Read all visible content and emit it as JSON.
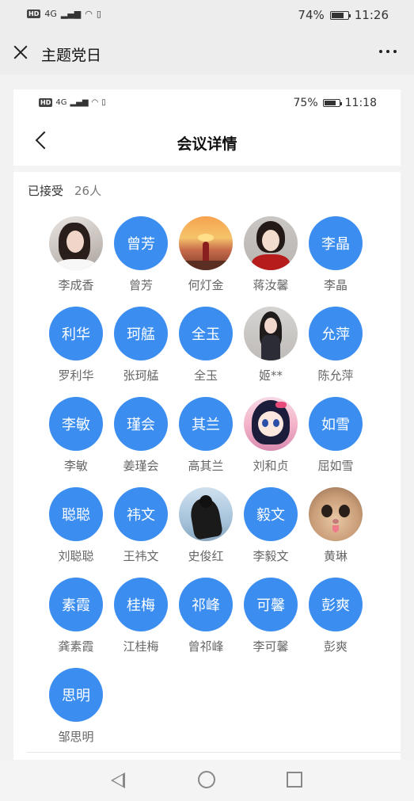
{
  "outer_status": {
    "hd": "HD",
    "network": "4G",
    "battery": "74%",
    "time": "11:26"
  },
  "outer_header": {
    "title": "主题党日"
  },
  "inner_status": {
    "hd": "HD",
    "network": "4G",
    "battery": "75%",
    "time": "11:18"
  },
  "inner_nav": {
    "title": "会议详情"
  },
  "accepted": {
    "label": "已接受",
    "count": "26人"
  },
  "colors": {
    "avatar_blue": "#3b8ef0"
  },
  "people": [
    {
      "name": "李成香",
      "avatar_text": "",
      "photo": "photo-1"
    },
    {
      "name": "曾芳",
      "avatar_text": "曾芳",
      "photo": ""
    },
    {
      "name": "何灯金",
      "avatar_text": "",
      "photo": "photo-3"
    },
    {
      "name": "蒋汝馨",
      "avatar_text": "",
      "photo": "photo-4"
    },
    {
      "name": "李晶",
      "avatar_text": "李晶",
      "photo": ""
    },
    {
      "name": "罗利华",
      "avatar_text": "利华",
      "photo": ""
    },
    {
      "name": "张珂艋",
      "avatar_text": "珂艋",
      "photo": ""
    },
    {
      "name": "全玉",
      "avatar_text": "全玉",
      "photo": ""
    },
    {
      "name": "姬**",
      "avatar_text": "",
      "photo": "photo-9"
    },
    {
      "name": "陈允萍",
      "avatar_text": "允萍",
      "photo": ""
    },
    {
      "name": "李敏",
      "avatar_text": "李敏",
      "photo": ""
    },
    {
      "name": "姜瑾会",
      "avatar_text": "瑾会",
      "photo": ""
    },
    {
      "name": "高其兰",
      "avatar_text": "其兰",
      "photo": ""
    },
    {
      "name": "刘和贞",
      "avatar_text": "",
      "photo": "photo-14"
    },
    {
      "name": "屈如雪",
      "avatar_text": "如雪",
      "photo": ""
    },
    {
      "name": "刘聪聪",
      "avatar_text": "聪聪",
      "photo": ""
    },
    {
      "name": "王祎文",
      "avatar_text": "祎文",
      "photo": ""
    },
    {
      "name": "史俊红",
      "avatar_text": "",
      "photo": "photo-18"
    },
    {
      "name": "李毅文",
      "avatar_text": "毅文",
      "photo": ""
    },
    {
      "name": "黄琳",
      "avatar_text": "",
      "photo": "photo-22"
    },
    {
      "name": "龚素霞",
      "avatar_text": "素霞",
      "photo": ""
    },
    {
      "name": "江桂梅",
      "avatar_text": "桂梅",
      "photo": ""
    },
    {
      "name": "曾祁峰",
      "avatar_text": "祁峰",
      "photo": ""
    },
    {
      "name": "李可馨",
      "avatar_text": "可馨",
      "photo": ""
    },
    {
      "name": "彭爽",
      "avatar_text": "彭爽",
      "photo": ""
    },
    {
      "name": "邹思明",
      "avatar_text": "思明",
      "photo": ""
    }
  ]
}
